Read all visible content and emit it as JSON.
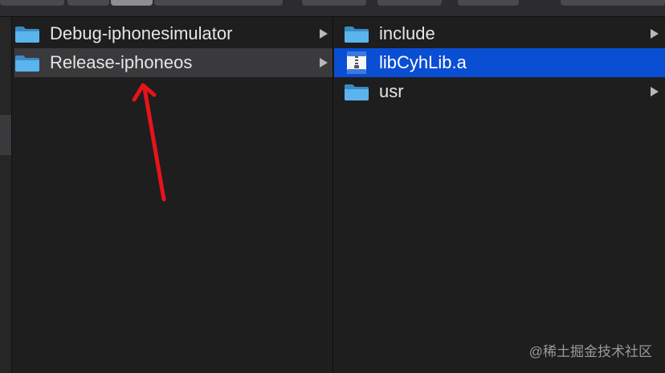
{
  "columns": [
    {
      "items": [
        {
          "label": "Debug-iphonesimulator",
          "icon": "folder-icon",
          "has_children": true,
          "state": "normal"
        },
        {
          "label": "Release-iphoneos",
          "icon": "folder-icon",
          "has_children": true,
          "state": "selected-inactive"
        }
      ]
    },
    {
      "items": [
        {
          "label": "include",
          "icon": "folder-icon",
          "has_children": true,
          "state": "normal"
        },
        {
          "label": "libCyhLib.a",
          "icon": "archive-file-icon",
          "has_children": false,
          "state": "selected-active"
        },
        {
          "label": "usr",
          "icon": "folder-icon",
          "has_children": true,
          "state": "normal"
        }
      ]
    }
  ],
  "colors": {
    "background": "#1e1e1f",
    "selection_active": "#0a4ed3",
    "selection_inactive": "#3a3a3c",
    "folder": "#4aa3df",
    "annotation_arrow": "#e8131a"
  },
  "watermark": "@稀土掘金技术社区"
}
